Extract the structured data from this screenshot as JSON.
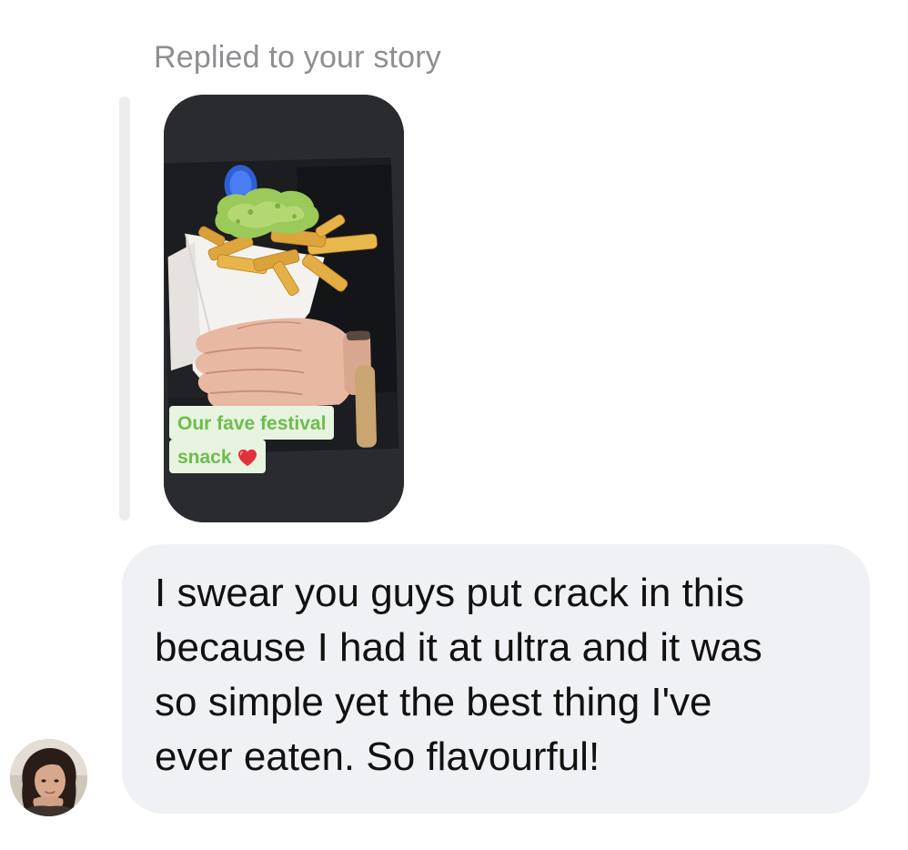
{
  "reply": {
    "header": "Replied to your story"
  },
  "story": {
    "sticker_line1": "Our fave festival",
    "sticker_line2": "snack",
    "sticker_emoji": "heart-emoji",
    "sticker_color": "#6dbd4e",
    "sticker_bg": "#e8f3e0"
  },
  "message": {
    "text": "I swear you guys put crack in this\nbecause I had it at ultra and it was\nso simple yet the best thing I've\never eaten. So flavourful!"
  },
  "colors": {
    "bubble_bg": "#f0f1f4",
    "header_text": "#8e8e93",
    "story_bg": "#2a2b2f"
  }
}
